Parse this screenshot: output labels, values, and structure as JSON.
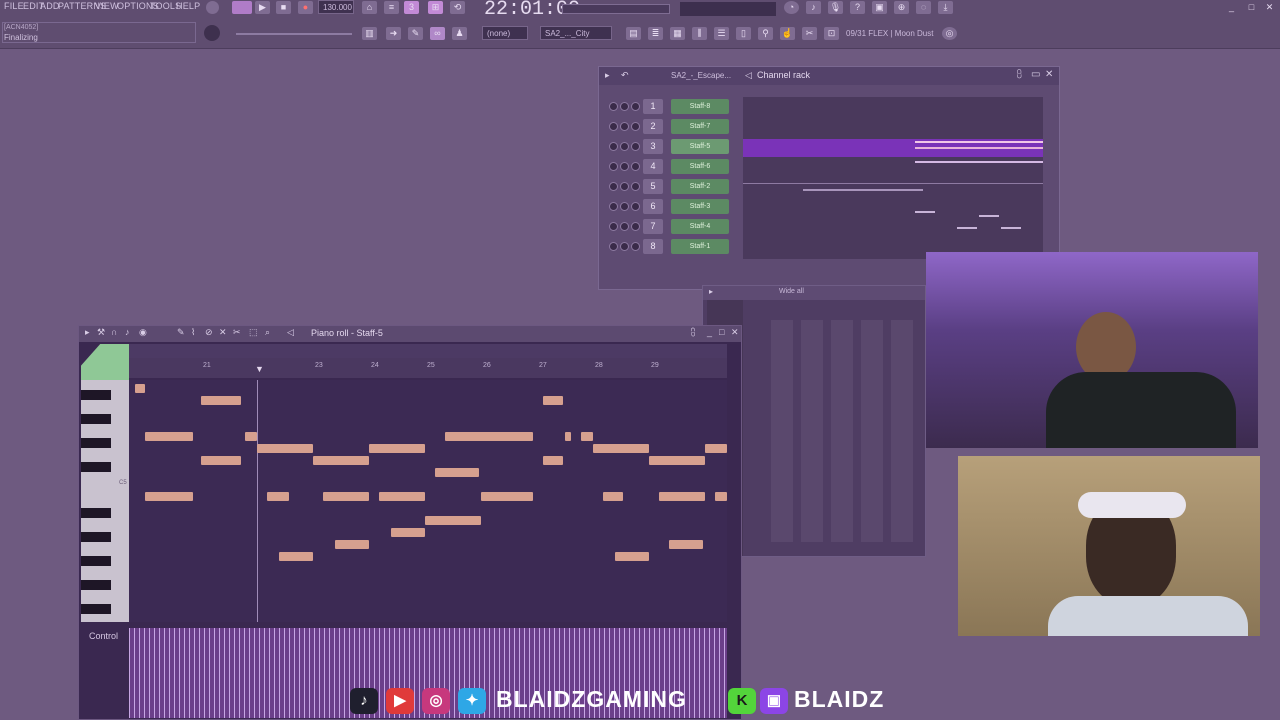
{
  "menubar": {
    "items": [
      "FILE",
      "EDIT",
      "ADD",
      "PATTERNS",
      "VIEW",
      "OPTIONS",
      "TOOLS",
      "HELP"
    ],
    "tempo": "130.000",
    "time": "22:01:00",
    "hint_line1": "[ACN4052]",
    "hint_line2": "Finalizing",
    "pattern_field": "(none)",
    "pattern_name": "SA2_..._City",
    "plugin_info": "09/31 FLEX | Moon Dust"
  },
  "channel_rack": {
    "tab": "SA2_-_Escape...",
    "title": "Channel rack",
    "channels": [
      {
        "num": "1",
        "name": "Staff-8"
      },
      {
        "num": "2",
        "name": "Staff-7"
      },
      {
        "num": "3",
        "name": "Staff-5"
      },
      {
        "num": "4",
        "name": "Staff-6"
      },
      {
        "num": "5",
        "name": "Staff-2"
      },
      {
        "num": "6",
        "name": "Staff-3"
      },
      {
        "num": "7",
        "name": "Staff-4"
      },
      {
        "num": "8",
        "name": "Staff-1"
      }
    ]
  },
  "mixer": {
    "title": "Wide all"
  },
  "piano_roll": {
    "title": "Piano roll - Staff-5",
    "bar_numbers": [
      "21",
      "23",
      "24",
      "25",
      "26",
      "27",
      "28",
      "29"
    ],
    "control_label": "Control",
    "c5_label": "C5"
  },
  "social": {
    "handle_primary": "BLAIDZGAMING",
    "handle_secondary": "BLAIDZ",
    "colors": {
      "tiktok": "#1f1f2e",
      "youtube": "#e03a3a",
      "instagram": "#c7387d",
      "twitter": "#2ea7e6",
      "kick": "#53d43b",
      "twitch": "#8c45e6"
    }
  },
  "icons": [
    "play-icon",
    "stop-icon",
    "record-icon",
    "snap-icon",
    "pencil-icon",
    "brush-icon",
    "knob-icon",
    "download-icon",
    "close-icon"
  ]
}
